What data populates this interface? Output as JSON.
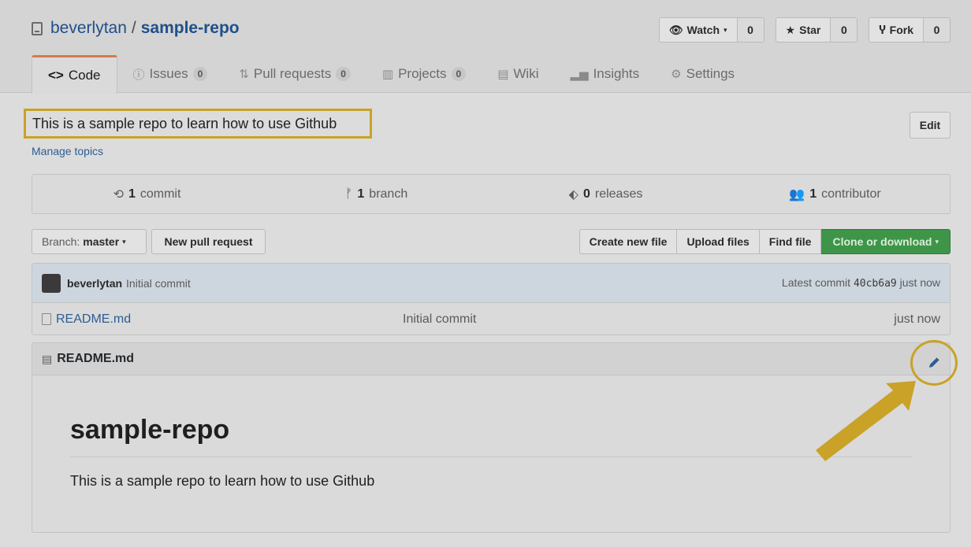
{
  "repo": {
    "owner": "beverlytan",
    "separator": "/",
    "name": "sample-repo"
  },
  "actions": [
    {
      "label": "Watch",
      "count": "0",
      "icon": "eye-icon"
    },
    {
      "label": "Star",
      "count": "0",
      "icon": "star-icon"
    },
    {
      "label": "Fork",
      "count": "0",
      "icon": "fork-icon"
    }
  ],
  "tabs": [
    {
      "label": "Code",
      "icon": "code-icon",
      "active": true
    },
    {
      "label": "Issues",
      "badge": "0",
      "icon": "issue-icon"
    },
    {
      "label": "Pull requests",
      "badge": "0",
      "icon": "pull-request-icon"
    },
    {
      "label": "Projects",
      "badge": "0",
      "icon": "project-icon"
    },
    {
      "label": "Wiki",
      "icon": "wiki-icon"
    },
    {
      "label": "Insights",
      "icon": "insights-icon"
    },
    {
      "label": "Settings",
      "icon": "gear-icon"
    }
  ],
  "description": "This is a sample repo to learn how to use Github",
  "manage_topics": "Manage topics",
  "edit_label": "Edit",
  "stats": [
    {
      "num": "1",
      "label": "commit",
      "icon": "history-icon"
    },
    {
      "num": "1",
      "label": "branch",
      "icon": "branch-icon"
    },
    {
      "num": "0",
      "label": "releases",
      "icon": "tag-icon"
    },
    {
      "num": "1",
      "label": "contributor",
      "icon": "people-icon"
    }
  ],
  "branch": {
    "prefix": "Branch:",
    "value": "master"
  },
  "new_pr": "New pull request",
  "file_buttons": {
    "create": "Create new file",
    "upload": "Upload files",
    "find": "Find file",
    "clone": "Clone or download"
  },
  "latest_commit": {
    "author": "beverlytan",
    "message": "Initial commit",
    "prefix": "Latest commit",
    "sha": "40cb6a9",
    "age": "just now"
  },
  "files": [
    {
      "name": "README.md",
      "message": "Initial commit",
      "age": "just now"
    }
  ],
  "readme": {
    "filename": "README.md",
    "heading": "sample-repo",
    "body": "This is a sample repo to learn how to use Github"
  },
  "colors": {
    "highlight": "#c9a227",
    "link": "#2d5d92",
    "clone": "#3e9548",
    "tab_accent": "#d47a4e"
  }
}
